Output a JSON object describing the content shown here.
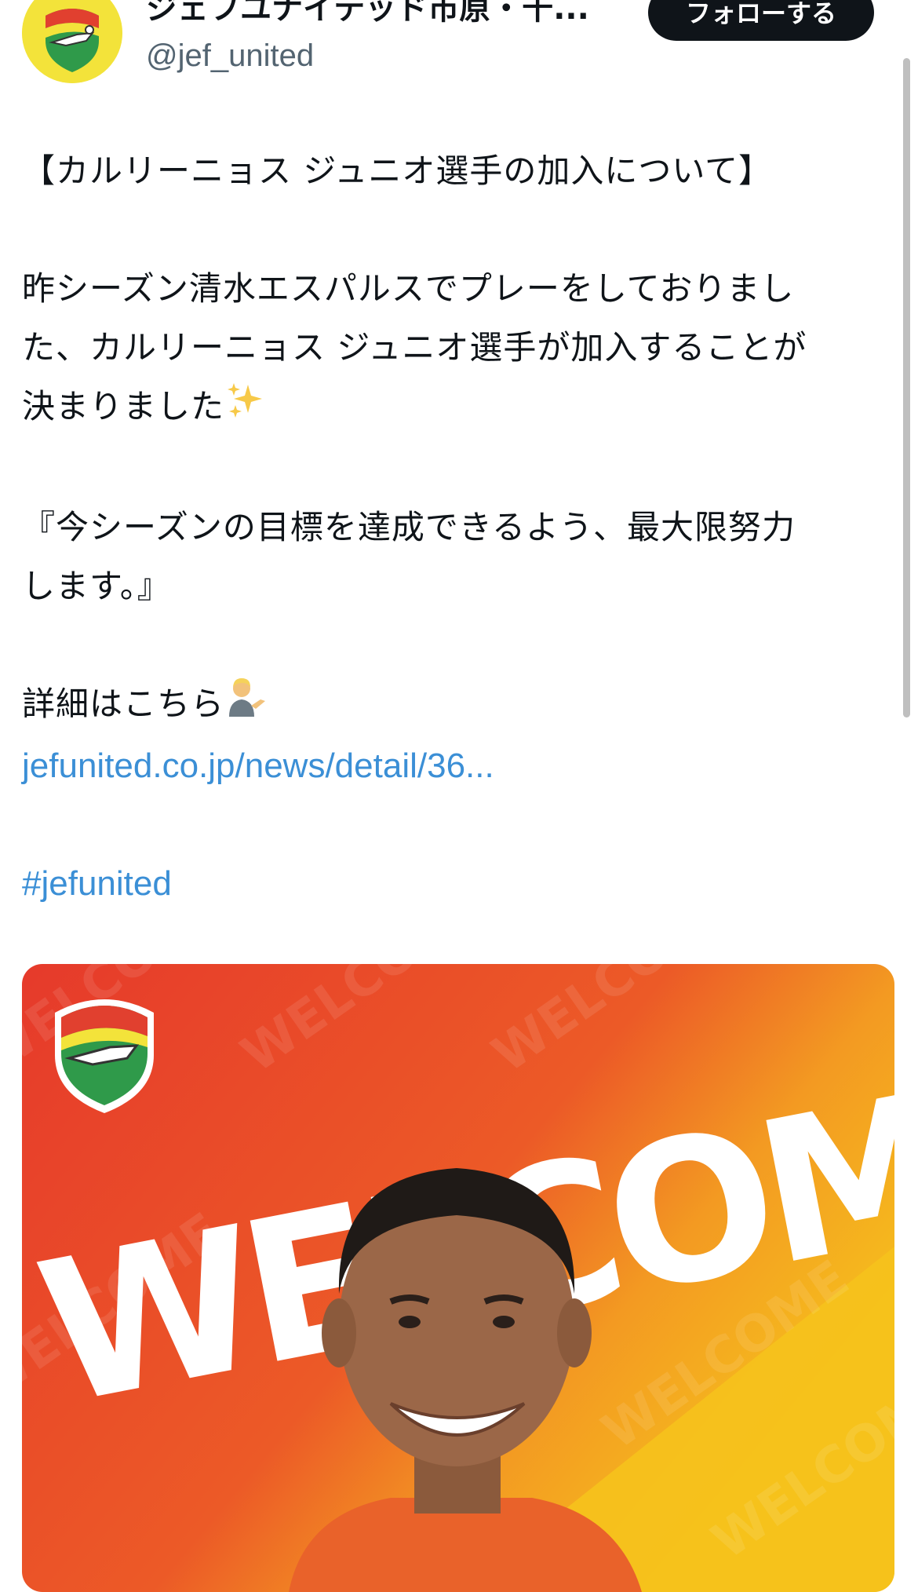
{
  "account": {
    "display_name": "ジェフユナイテッド市原・千...",
    "handle": "@jef_united",
    "follow_label": "フォローする"
  },
  "tweet": {
    "line1": "【カルリーニョス ジュニオ選手の加入について】",
    "line2": "昨シーズン清水エスパルスでプレーをしておりまし",
    "line3": "た、カルリーニョス ジュニオ選手が加入することが",
    "line4": "決まりました",
    "line5": "『今シーズンの目標を達成できるよう、最大限努力",
    "line6": "します。』",
    "line7": "詳細はこちら",
    "link": "jefunited.co.jp/news/detail/36...",
    "hashtag": "#jefunited"
  },
  "media": {
    "headline": "WELCOME",
    "watermark": "WELCOME"
  },
  "icons": {
    "sparkles": "sparkles-icon",
    "person_tipping_hand": "person-tipping-hand-icon"
  },
  "colors": {
    "link": "#3b8fd6",
    "follow_bg": "#0f1419",
    "media_red": "#e63a2b",
    "media_yellow": "#f6c21c"
  }
}
